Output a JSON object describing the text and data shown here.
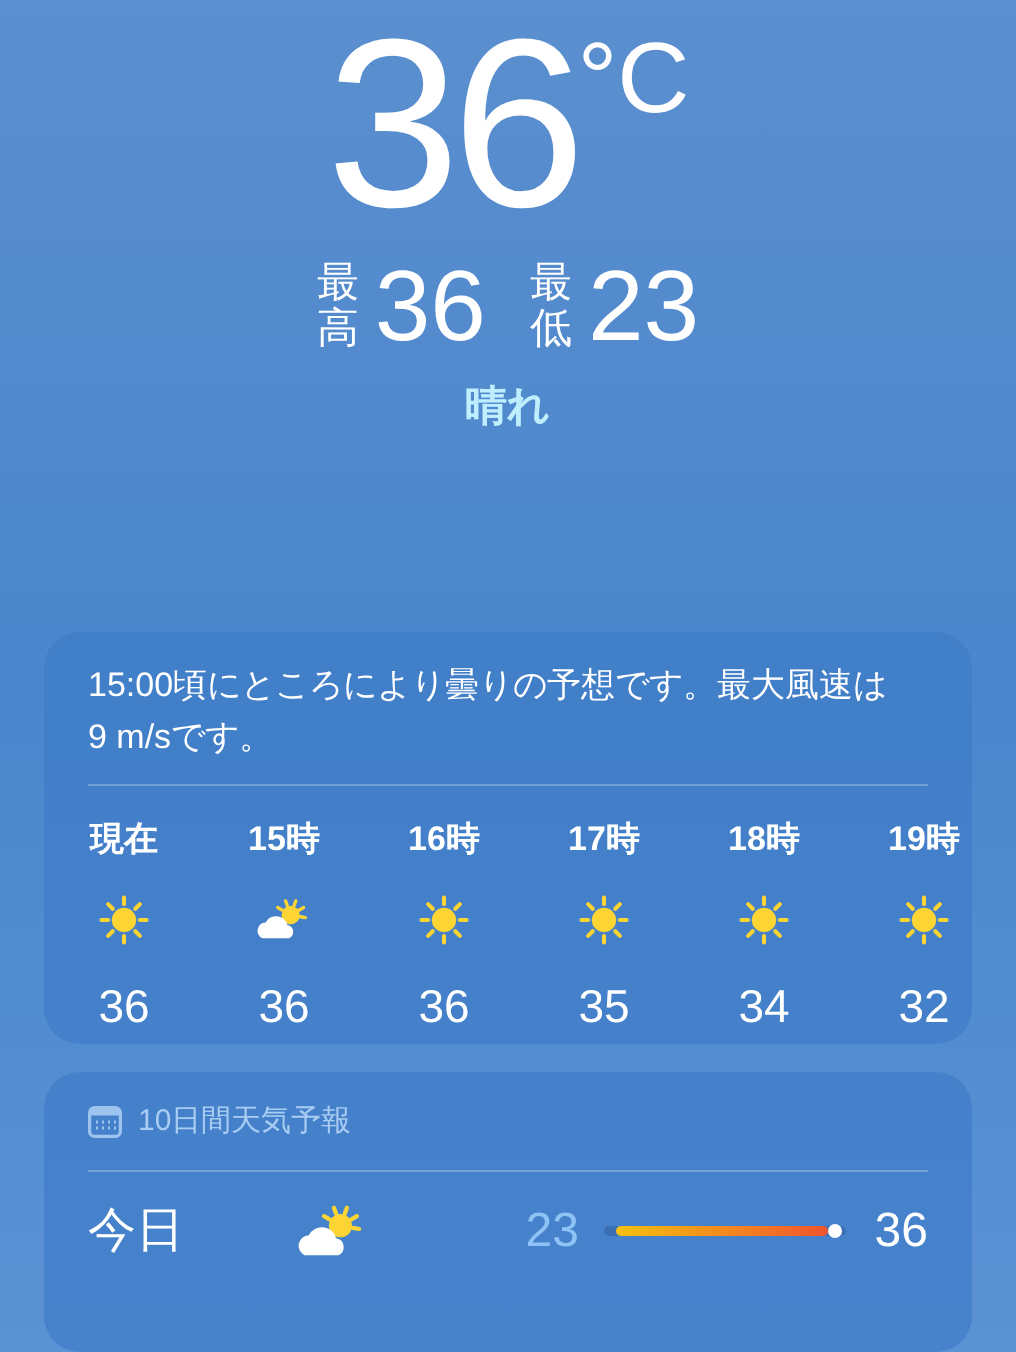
{
  "current": {
    "temperature": "36",
    "unit": "°C",
    "high_label": "最高",
    "high": "36",
    "low_label": "最低",
    "low": "23",
    "condition": "晴れ"
  },
  "hourly": {
    "summary": "15:00頃にところにより曇りの予想です。最大風速は9 m/sです。",
    "items": [
      {
        "time": "現在",
        "kind": "sun",
        "temp": "36"
      },
      {
        "time": "15時",
        "kind": "partly_cloudy",
        "temp": "36"
      },
      {
        "time": "16時",
        "kind": "sun",
        "temp": "36"
      },
      {
        "time": "17時",
        "kind": "sun",
        "temp": "35"
      },
      {
        "time": "18時",
        "kind": "sun",
        "temp": "34"
      },
      {
        "time": "19時",
        "kind": "sun",
        "temp": "32"
      }
    ]
  },
  "daily": {
    "title": "10日間天気予報",
    "days": [
      {
        "day": "今日",
        "kind": "partly_cloudy",
        "low": "23",
        "high": "36",
        "level": 0.96
      }
    ]
  }
}
